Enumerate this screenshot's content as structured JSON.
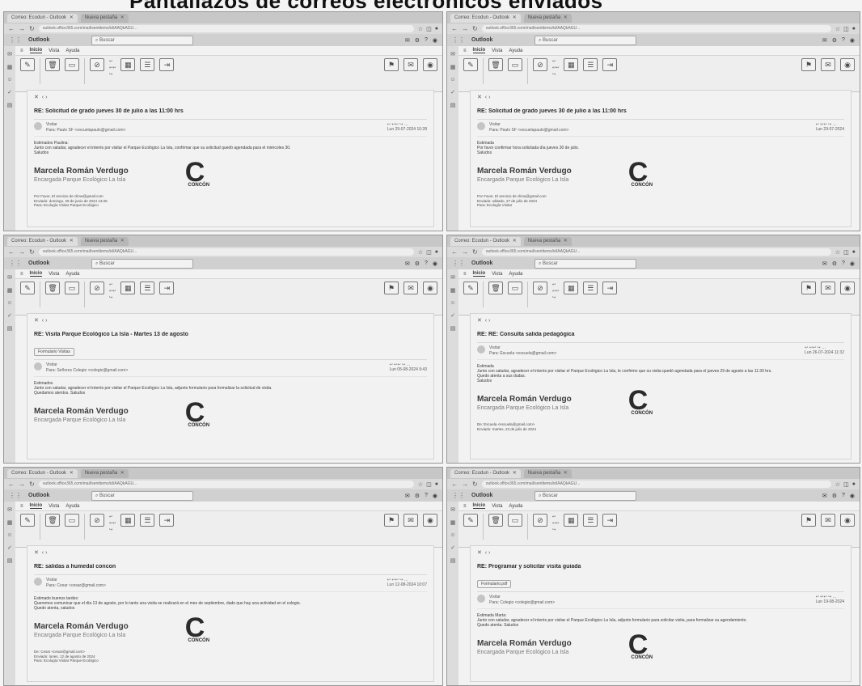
{
  "page_title": "Pantallazos de correos electrónicos enviados",
  "shots": [
    {
      "tabs": [
        "Correo: Ecodun - Outlook",
        "Nueva pestaña"
      ],
      "url": "outlook.office365.com/mail/sentitems/id/AAQkAGU...",
      "app_name": "Outlook",
      "search_placeholder": "Buscar",
      "menu_tabs": [
        "Inicio",
        "Vista",
        "Ayuda"
      ],
      "subject": "RE: Solicitud de grado jueves 30 de julio a las 11:00 hrs",
      "attachment": "",
      "sender_name": "Visitar",
      "sender_to": "Para: Paulo SF <escuelapaulo@gmail.com>",
      "date": "Lun 29-07-2024 10:28",
      "body": [
        "Estimados Paulina:",
        "Junto con saludar, agradecer el interés por visitar el Parque Ecológico La Isla, confirmar que su solicitud quedó agendada para el miércoles 30.",
        "Saludos"
      ],
      "sig_name": "Marcela Román Verdugo",
      "sig_role": "Encargada Parque Ecológico La Isla",
      "logo_text": "CONCÓN",
      "footer": [
        "Por Favor, El servicio de clima@gmail.com",
        "Enviado: domingo, 29 de junio de 2024 13:26",
        "Para: Ecología Visitar Parque Ecológico"
      ]
    },
    {
      "tabs": [
        "Correo: Ecodun - Outlook",
        "Nueva pestaña"
      ],
      "url": "outlook.office365.com/mail/sentitems/id/AAQkAGU...",
      "app_name": "Outlook",
      "search_placeholder": "Buscar",
      "menu_tabs": [
        "Inicio",
        "Vista",
        "Ayuda"
      ],
      "subject": "RE: Solicitud de grado jueves 30 de julio a las 11:00 hrs",
      "attachment": "",
      "sender_name": "Visitar",
      "sender_to": "Para: Paulo SF <escuelapaulo@gmail.com>",
      "date": "Lun 29-07-2024",
      "body": [
        "Estimada",
        "Por favor confirmar hora solicitada día jueves 30 de julio.",
        "Saludos"
      ],
      "sig_name": "Marcela Román Verdugo",
      "sig_role": "Encargada Parque Ecológico La Isla",
      "logo_text": "CONCÓN",
      "footer": [
        "Por Favor, El servicio de clima@gmail.com",
        "Enviado: sábado, 27 de julio de 2024",
        "Para: Ecología Visitar"
      ]
    },
    {
      "tabs": [
        "Correo: Ecodun - Outlook",
        "Nueva pestaña"
      ],
      "url": "outlook.office365.com/mail/sentitems/id/AAQkAGU...",
      "app_name": "Outlook",
      "search_placeholder": "Buscar",
      "menu_tabs": [
        "Inicio",
        "Vista",
        "Ayuda"
      ],
      "subject": "RE: Visita Parque Ecológico La Isla - Martes 13 de agosto",
      "attachment": "Formulario Visitas",
      "sender_name": "Visitar",
      "sender_to": "Para: Señores Colegio <colegio@gmail.com>",
      "date": "Lun 05-08-2024 9:43",
      "body": [
        "Estimados",
        "Junto con saludar, agradecer el interés por visitar el Parque Ecológico La Isla, adjunto formulario para formalizar la solicitud de visita.",
        "Quedamos atentos. Saludos"
      ],
      "sig_name": "Marcela Román Verdugo",
      "sig_role": "Encargada Parque Ecológico La Isla",
      "logo_text": "CONCÓN",
      "footer": []
    },
    {
      "tabs": [
        "Correo: Ecodun - Outlook",
        "Nueva pestaña"
      ],
      "url": "outlook.office365.com/mail/sentitems/id/AAQkAGU...",
      "app_name": "Outlook",
      "search_placeholder": "Buscar",
      "menu_tabs": [
        "Inicio",
        "Vista",
        "Ayuda"
      ],
      "subject": "RE: RE: Consulta salida pedagógica",
      "attachment": "",
      "sender_name": "Visitar",
      "sender_to": "Para: Escuela <escuela@gmail.com>",
      "date": "Lun 26-07-2024 11:32",
      "body": [
        "Estimada",
        "Junto con saludar, agradecer el interés por visitar el Parque Ecológico La Isla, le confirmo que su visita quedó agendada para el jueves 29 de agosto a las 11:30 hrs.",
        "Quedo atenta a sus dudas.",
        "Saludos"
      ],
      "sig_name": "Marcela Román Verdugo",
      "sig_role": "Encargada Parque Ecológico La Isla",
      "logo_text": "CONCÓN",
      "footer": [
        "De: Escuela <escuela@gmail.com>",
        "Enviado: martes, 23 de julio de 2024"
      ]
    },
    {
      "tabs": [
        "Correo: Ecodun - Outlook",
        "Nueva pestaña"
      ],
      "url": "outlook.office365.com/mail/sentitems/id/AAQkAGU...",
      "app_name": "Outlook",
      "search_placeholder": "Buscar",
      "menu_tabs": [
        "Inicio",
        "Vista",
        "Ayuda"
      ],
      "subject": "RE: salidas a humedal concon",
      "attachment": "",
      "sender_name": "Visitar",
      "sender_to": "Para: Cesar <cesar@gmail.com>",
      "date": "Lun 12-08-2024 10:07",
      "body": [
        "Estimado buenos tardes:",
        "Queremos comunicar que el día 13 de agosto, por lo tanto una visita se realizará en el mes de septiembre, dado que hay una actividad en el colegio.",
        "Quedo atenta, saludos"
      ],
      "sig_name": "Marcela Román Verdugo",
      "sig_role": "Encargada Parque Ecológico La Isla",
      "logo_text": "CONCÓN",
      "footer": [
        "De: Cesar <cesar@gmail.com>",
        "Enviado: lunes, 12 de agosto de 2024",
        "Para: Ecología Visitar Parque Ecológico"
      ]
    },
    {
      "tabs": [
        "Correo: Ecodun - Outlook",
        "Nueva pestaña"
      ],
      "url": "outlook.office365.com/mail/sentitems/id/AAQkAGU...",
      "app_name": "Outlook",
      "search_placeholder": "Buscar",
      "menu_tabs": [
        "Inicio",
        "Vista",
        "Ayuda"
      ],
      "subject": "RE: Programar y solicitar visita guiada",
      "attachment": "Formulario.pdf",
      "sender_name": "Visitar",
      "sender_to": "Para: Colegio <colegio@gmail.com>",
      "date": "Lun 19-08-2024",
      "body": [
        "Estimada Marta:",
        "Junto con saludar, agradecer el interés por visitar el Parque Ecológico La Isla, adjunto formulario para solicitar visita, para formalizar su agendamiento.",
        "Quedo atenta. Saludos"
      ],
      "sig_name": "Marcela Román Verdugo",
      "sig_role": "Encargada Parque Ecológico La Isla",
      "logo_text": "CONCÓN",
      "footer": []
    }
  ]
}
